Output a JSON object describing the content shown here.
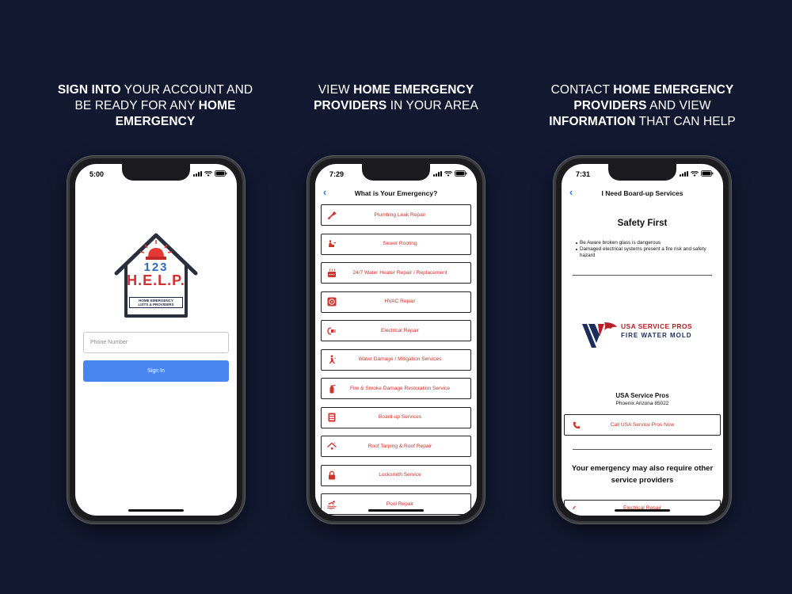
{
  "captions": {
    "col1": {
      "b1": "SIGN INTO",
      "t1": " YOUR ACCOUNT AND BE READY FOR ANY ",
      "b2": "HOME EMERGENCY"
    },
    "col2": {
      "t1": "VIEW ",
      "b1": "HOME EMERGENCY PROVIDERS",
      "t2": " IN YOUR AREA"
    },
    "col3": {
      "t1": "CONTACT ",
      "b1": "HOME EMERGENCY PROVIDERS",
      "t2": " AND VIEW ",
      "b2": "INFORMATION",
      "t3": " THAT CAN HELP"
    }
  },
  "screen1": {
    "time": "5:00",
    "logo": {
      "number": "123",
      "name": "H.E.L.P.",
      "tagline_line1": "HOME EMERGENCY",
      "tagline_line2": "LISTS & PROVIDERS"
    },
    "phone_placeholder": "Phone Number",
    "signin_label": "Sign In"
  },
  "screen2": {
    "time": "7:29",
    "title": "What is Your Emergency?",
    "items": [
      {
        "label": "Plumbing Leak Repair",
        "icon": "wrench-icon"
      },
      {
        "label": "Sewer Rooting",
        "icon": "sewer-icon"
      },
      {
        "label": "24/7 Water Heater Repair / Replacement",
        "icon": "water-heater-icon"
      },
      {
        "label": "HVAC Repair",
        "icon": "hvac-icon"
      },
      {
        "label": "Electrical Repair",
        "icon": "plug-icon"
      },
      {
        "label": "Water Damage / Mitigation Services",
        "icon": "water-damage-icon"
      },
      {
        "label": "Fire & Smoke Damage Restoration Service",
        "icon": "fire-extinguisher-icon"
      },
      {
        "label": "Board-up Services",
        "icon": "board-up-icon"
      },
      {
        "label": "Roof Tarping & Roof Repair",
        "icon": "roof-icon"
      },
      {
        "label": "Locksmith Service",
        "icon": "lock-icon"
      },
      {
        "label": "Pool Repair",
        "icon": "pool-icon"
      }
    ]
  },
  "screen3": {
    "time": "7:31",
    "title": "I Need Board-up Services",
    "safety_title": "Safety First",
    "safety_tips": [
      "Be Aware broken glass is dangerous",
      "Damaged electrical systems present a fire risk and safety hazard"
    ],
    "provider_logo": {
      "name": "USA SERVICE PROS",
      "subtitle": "FIRE WATER MOLD"
    },
    "provider_name": "USA Service Pros",
    "provider_location": "Phoenix Arizona 85022",
    "call_label": "Call USA Service Pros Now",
    "also_title": "Your emergency may also require other service providers",
    "partial_item_label": "Electrical Repair"
  },
  "colors": {
    "background": "#111830",
    "accent_red": "#d0322c",
    "link_blue": "#2f7ce8",
    "signin_blue": "#4a86f0"
  }
}
